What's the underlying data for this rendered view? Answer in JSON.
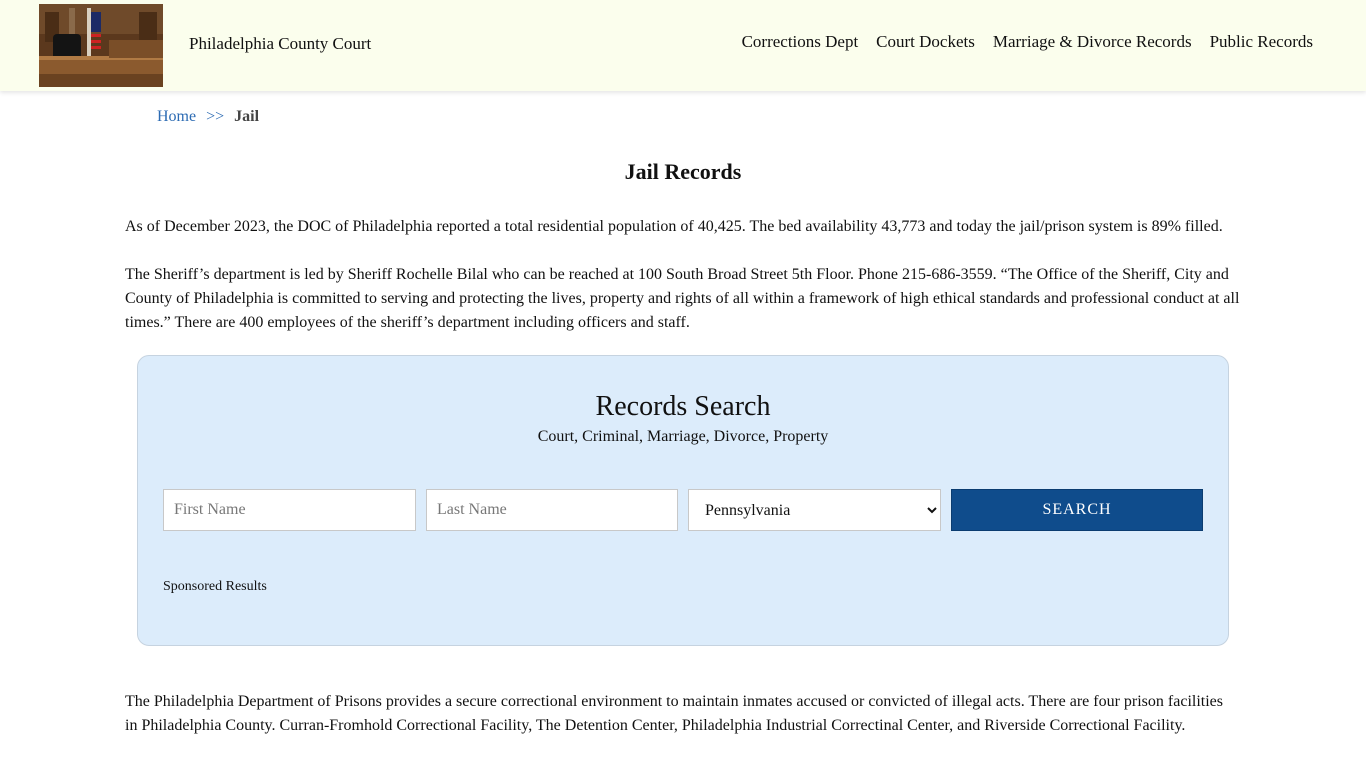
{
  "header": {
    "site_title": "Philadelphia County Court",
    "nav": [
      {
        "label": "Corrections Dept"
      },
      {
        "label": "Court Dockets"
      },
      {
        "label": "Marriage & Divorce Records"
      },
      {
        "label": "Public Records"
      }
    ]
  },
  "breadcrumb": {
    "home": "Home",
    "separator": ">>",
    "current": "Jail"
  },
  "main": {
    "title": "Jail Records",
    "paragraph1": "As of December 2023, the DOC of Philadelphia reported a total residential population of 40,425. The bed availability 43,773 and today the jail/prison system is 89% filled.",
    "paragraph2": "The Sheriff’s department is led by Sheriff Rochelle Bilal who can be reached at 100 South Broad Street 5th Floor. Phone 215-686-3559. “The Office of the Sheriff, City and County of Philadelphia is committed to serving and protecting the lives, property and rights of all within a framework of high ethical standards and professional conduct at all times.” There are 400 employees of the sheriff’s department including officers and staff.",
    "paragraph3": "The Philadelphia Department of Prisons provides a secure correctional environment to maintain inmates accused or convicted of illegal acts. There are four prison facilities in Philadelphia County. Curran-Fromhold Correctional Facility, The Detention Center, Philadelphia Industrial Correctinal Center, and Riverside Correctional Facility."
  },
  "search": {
    "title": "Records Search",
    "subtitle": "Court, Criminal, Marriage, Divorce, Property",
    "first_name": {
      "value": "",
      "placeholder": "First Name"
    },
    "last_name": {
      "value": "",
      "placeholder": "Last Name"
    },
    "state": {
      "selected": "Pennsylvania"
    },
    "button_label": "SEARCH",
    "sponsored": "Sponsored Results"
  },
  "colors": {
    "header_bg": "#fbfeed",
    "search_box_bg": "#dcecfb",
    "button_bg": "#0f4c8c",
    "link": "#2c6bb3"
  },
  "icons": {
    "logo": "courtroom-photo"
  }
}
